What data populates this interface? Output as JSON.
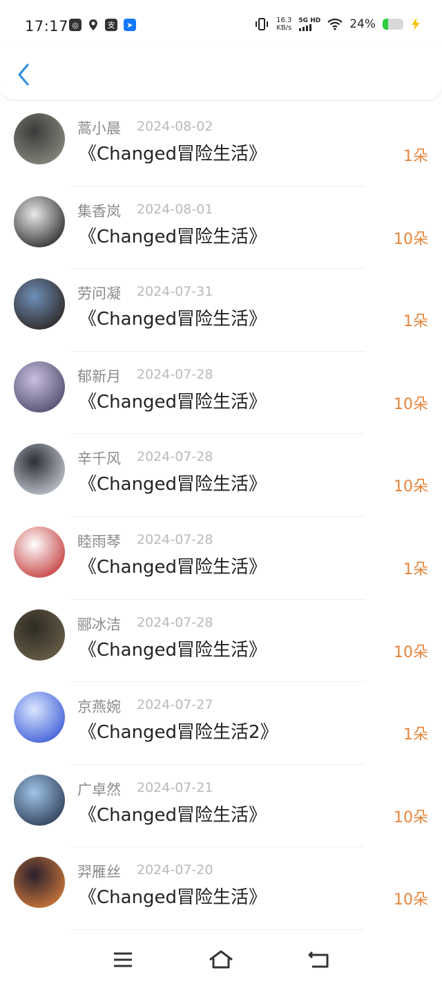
{
  "status_bar": {
    "time": "17:17",
    "speed_value": "16.3",
    "speed_unit": "KB/s",
    "network": "5G HD",
    "battery": "24%"
  },
  "colors": {
    "accent": "#2f8fe0",
    "amount": "#e8833a",
    "name": "#8a8a8a",
    "date": "#b9b9b9"
  },
  "list": [
    {
      "name": "蒿小晨",
      "date": "2024-08-02",
      "book": "《Changed冒险生活》",
      "amount": "1朵"
    },
    {
      "name": "集香岚",
      "date": "2024-08-01",
      "book": "《Changed冒险生活》",
      "amount": "10朵"
    },
    {
      "name": "劳问凝",
      "date": "2024-07-31",
      "book": "《Changed冒险生活》",
      "amount": "1朵"
    },
    {
      "name": "郁新月",
      "date": "2024-07-28",
      "book": "《Changed冒险生活》",
      "amount": "10朵"
    },
    {
      "name": "辛千风",
      "date": "2024-07-28",
      "book": "《Changed冒险生活》",
      "amount": "10朵"
    },
    {
      "name": "睦雨琴",
      "date": "2024-07-28",
      "book": "《Changed冒险生活》",
      "amount": "1朵"
    },
    {
      "name": "郦冰洁",
      "date": "2024-07-28",
      "book": "《Changed冒险生活》",
      "amount": "10朵"
    },
    {
      "name": "京燕婉",
      "date": "2024-07-27",
      "book": "《Changed冒险生活2》",
      "amount": "1朵"
    },
    {
      "name": "广卓然",
      "date": "2024-07-21",
      "book": "《Changed冒险生活》",
      "amount": "10朵"
    },
    {
      "name": "羿雁丝",
      "date": "2024-07-20",
      "book": "《Changed冒险生活》",
      "amount": "10朵"
    }
  ],
  "avatar_colors": [
    [
      "#3b3b3b",
      "#8a8a80"
    ],
    [
      "#e9e9e9",
      "#2a2a2a"
    ],
    [
      "#6f8fb8",
      "#2b2420"
    ],
    [
      "#c9bfe0",
      "#4e4a6a"
    ],
    [
      "#2b2f36",
      "#c5c9d2"
    ],
    [
      "#ffffff",
      "#c43a3a"
    ],
    [
      "#2e2b23",
      "#6a5f4a"
    ],
    [
      "#dbe6ff",
      "#3b5bd6"
    ],
    [
      "#9fc4e8",
      "#2d3b55"
    ],
    [
      "#2a1f2e",
      "#d07a3a"
    ]
  ]
}
